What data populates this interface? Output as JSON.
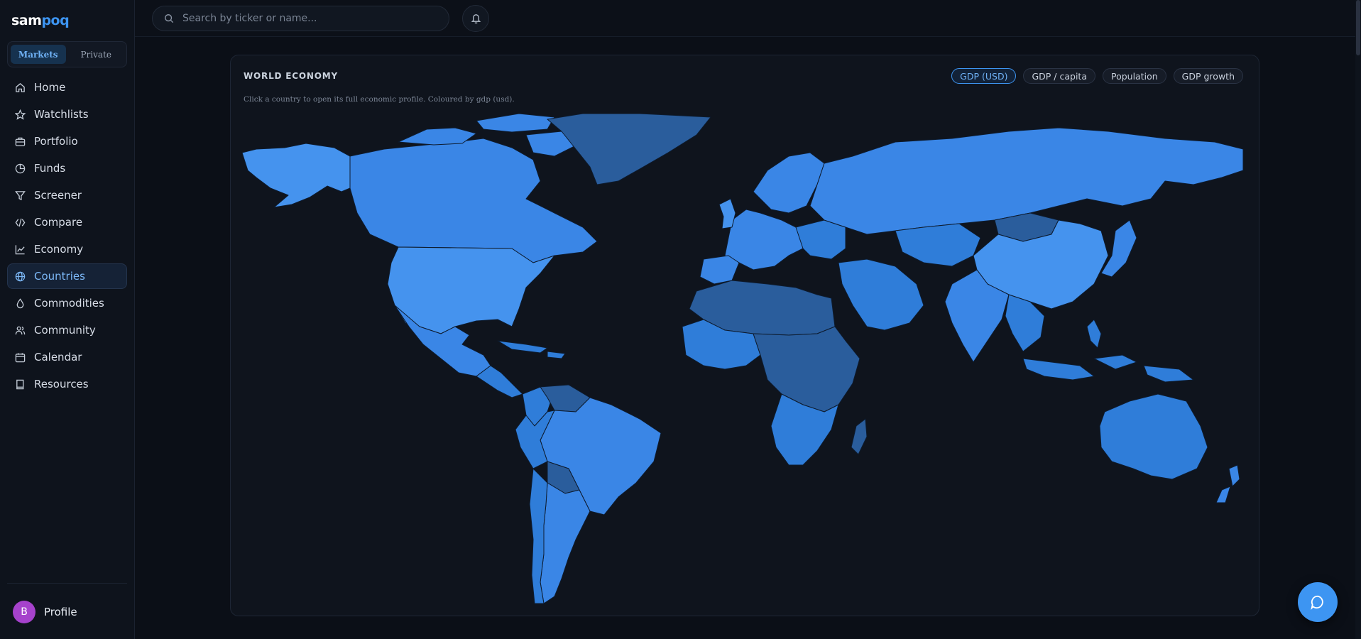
{
  "brand": {
    "part1": "sam",
    "part2": "poq"
  },
  "mode_toggle": {
    "markets": "Markets",
    "private": "Private",
    "active": "Markets"
  },
  "nav": {
    "items": [
      {
        "id": "home",
        "label": "Home",
        "icon": "home-icon"
      },
      {
        "id": "watchlists",
        "label": "Watchlists",
        "icon": "star-icon"
      },
      {
        "id": "portfolio",
        "label": "Portfolio",
        "icon": "briefcase-icon"
      },
      {
        "id": "funds",
        "label": "Funds",
        "icon": "pie-chart-icon"
      },
      {
        "id": "screener",
        "label": "Screener",
        "icon": "filter-icon"
      },
      {
        "id": "compare",
        "label": "Compare",
        "icon": "code-icon"
      },
      {
        "id": "economy",
        "label": "Economy",
        "icon": "line-chart-icon"
      },
      {
        "id": "countries",
        "label": "Countries",
        "icon": "globe-icon"
      },
      {
        "id": "commodities",
        "label": "Commodities",
        "icon": "droplet-icon"
      },
      {
        "id": "community",
        "label": "Community",
        "icon": "users-icon"
      },
      {
        "id": "calendar",
        "label": "Calendar",
        "icon": "calendar-icon"
      },
      {
        "id": "resources",
        "label": "Resources",
        "icon": "book-icon"
      }
    ],
    "active": "countries"
  },
  "profile": {
    "initial": "B",
    "label": "Profile"
  },
  "search": {
    "placeholder": "Search by ticker or name..."
  },
  "card": {
    "title": "WORLD ECONOMY",
    "subtitle": "Click a country to open its full economic profile. Coloured by gdp (usd).",
    "metrics": [
      "GDP (USD)",
      "GDP / capita",
      "Population",
      "GDP growth"
    ],
    "active_metric": "GDP (USD)"
  },
  "colors": {
    "accent": "#3d95f2",
    "map_high": "#4593ee",
    "map_mid": "#2f7dd9",
    "map_low": "#2a5d9c",
    "background": "#0b0f17"
  }
}
